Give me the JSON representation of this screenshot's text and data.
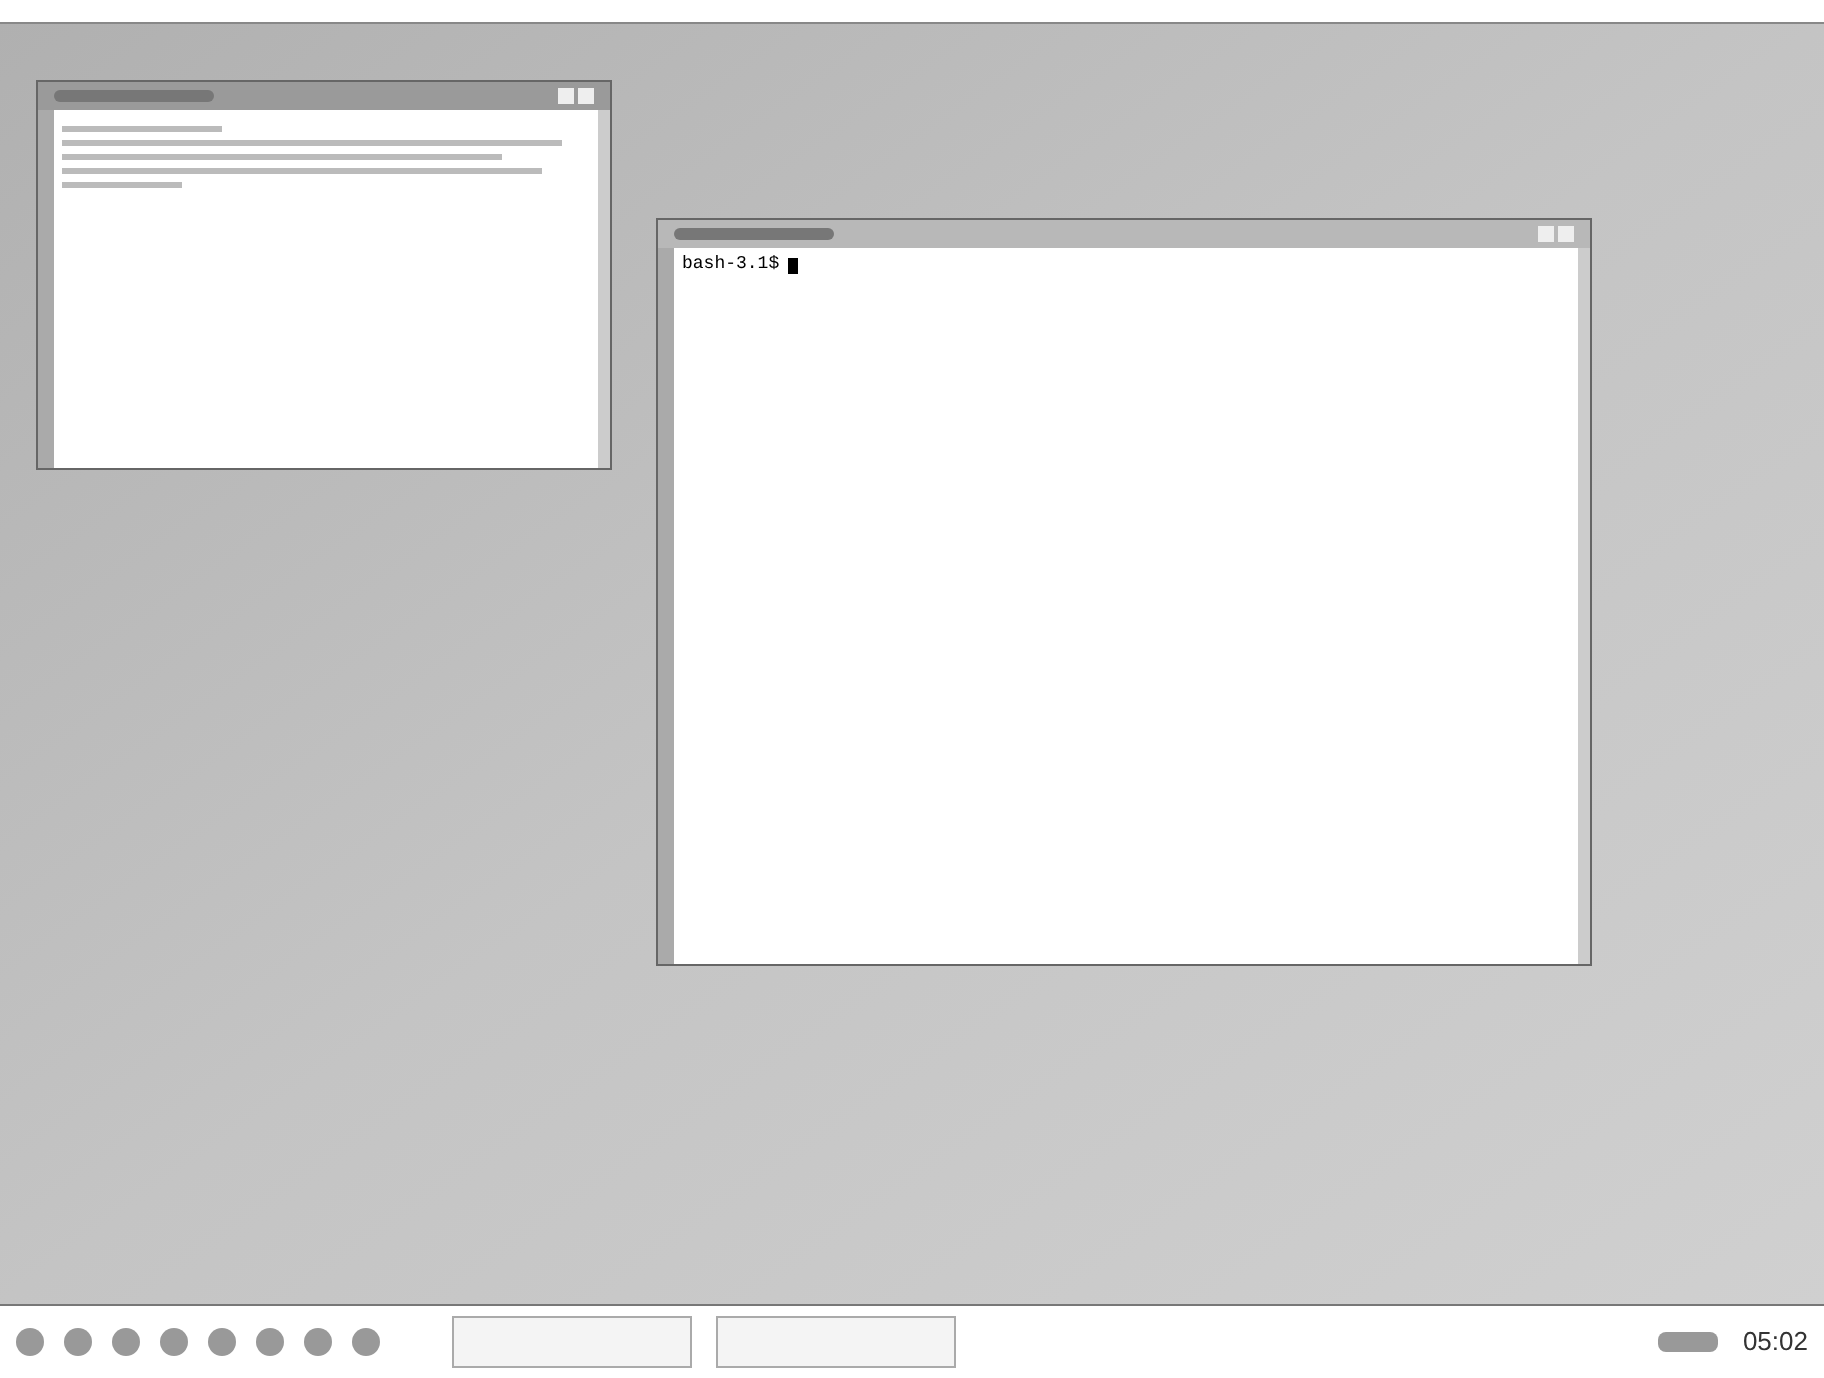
{
  "windows": [
    {
      "kind": "text",
      "focused": false
    },
    {
      "kind": "terminal",
      "focused": true,
      "prompt": "bash-3.1$"
    }
  ],
  "taskbar": {
    "clock": "05:02"
  }
}
